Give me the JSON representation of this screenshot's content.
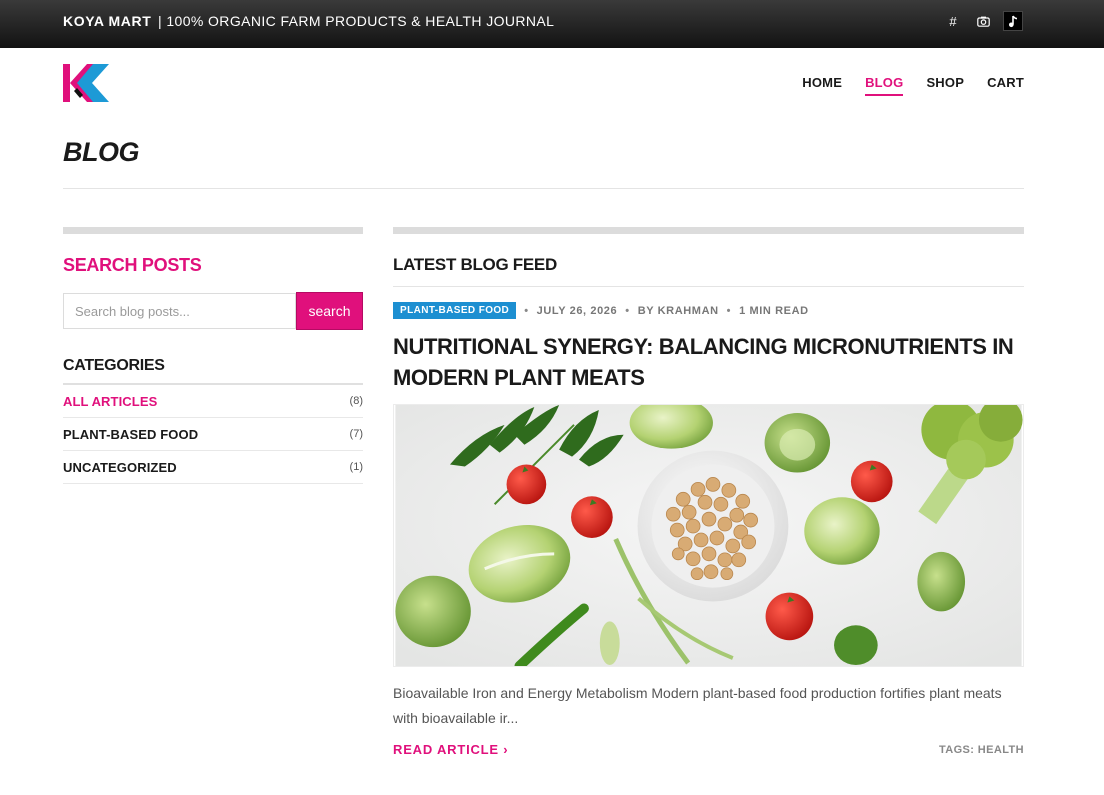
{
  "topbar": {
    "brand": "KOYA MART",
    "tagline": "| 100% ORGANIC FARM PRODUCTS & HEALTH JOURNAL",
    "icons": [
      "hashtag-icon",
      "camera-icon",
      "music-note-icon"
    ]
  },
  "nav": {
    "items": [
      {
        "label": "HOME"
      },
      {
        "label": "BLOG"
      },
      {
        "label": "SHOP"
      },
      {
        "label": "CART"
      }
    ],
    "active": "BLOG"
  },
  "page": {
    "title": "BLOG"
  },
  "sidebar": {
    "search_heading": "SEARCH POSTS",
    "search_placeholder": "Search blog posts...",
    "search_button": "search",
    "categories_heading": "CATEGORIES",
    "categories": [
      {
        "label": "ALL ARTICLES",
        "count": "(8)"
      },
      {
        "label": "PLANT-BASED FOOD",
        "count": "(7)"
      },
      {
        "label": "UNCATEGORIZED",
        "count": "(1)"
      }
    ]
  },
  "feed": {
    "heading": "LATEST BLOG FEED",
    "post": {
      "category": "PLANT-BASED FOOD",
      "date": "JULY 26, 2026",
      "author": "BY KRAHMAN",
      "read_time": "1 MIN READ",
      "title": "NUTRITIONAL SYNERGY: BALANCING MICRONUTRIENTS IN MODERN PLANT MEATS",
      "excerpt": "Bioavailable Iron and Energy Metabolism Modern plant-based food production fortifies plant meats with bioavailable ir...",
      "read_more": "READ ARTICLE ›",
      "tags": "TAGS: HEALTH"
    }
  },
  "colors": {
    "accent": "#e0107c",
    "badge": "#1d8fd1",
    "logo_pink": "#e0107c",
    "logo_blue": "#1d9ad6"
  }
}
